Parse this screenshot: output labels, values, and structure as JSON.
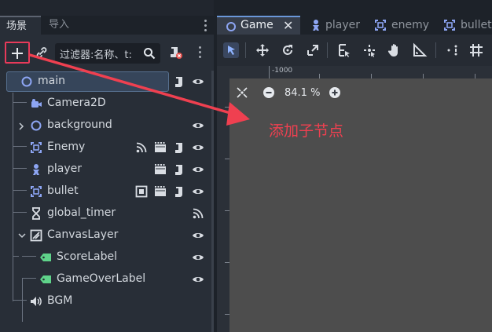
{
  "dock": {
    "scene_tab": "场景",
    "import_tab": "导入"
  },
  "scene_toolbar": {
    "add_icon": "plus-icon",
    "link_icon": "link-icon",
    "filter_placeholder": "过滤器:名称、t:",
    "filter_icon": "search-icon",
    "script_icon": "script-remove-icon",
    "menu_icon": "kebab-menu-icon"
  },
  "tree": [
    {
      "name": "main",
      "icon": "node2d-ring-icon",
      "selected": true,
      "right": [
        "script-icon",
        "eye-icon"
      ]
    },
    {
      "name": "Camera2D",
      "icon": "camera-icon",
      "right": []
    },
    {
      "name": "background",
      "icon": "node2d-ring-icon",
      "collapsed": true,
      "right": [
        "eye-icon"
      ]
    },
    {
      "name": "Enemy",
      "icon": "area2d-icon",
      "right": [
        "signal-icon",
        "scene-icon",
        "script-icon",
        "eye-icon"
      ]
    },
    {
      "name": "player",
      "icon": "character-icon",
      "right": [
        "scene-icon",
        "script-icon",
        "eye-icon"
      ]
    },
    {
      "name": "bullet",
      "icon": "area2d-icon",
      "right": [
        "group-icon",
        "scene-icon",
        "script-icon",
        "eye-icon"
      ]
    },
    {
      "name": "global_timer",
      "icon": "timer-icon",
      "right": [
        "signal-icon"
      ]
    },
    {
      "name": "CanvasLayer",
      "icon": "canvaslayer-icon",
      "expanded": true,
      "right": [
        "eye-icon"
      ]
    },
    {
      "name": "ScoreLabel",
      "icon": "label-icon",
      "right": [
        "eye-icon"
      ]
    },
    {
      "name": "GameOverLabel",
      "icon": "label-icon",
      "right": [
        "eye-icon"
      ]
    },
    {
      "name": "BGM",
      "icon": "audio-icon",
      "right": []
    }
  ],
  "editor_tabs": [
    {
      "label": "Game",
      "active": true,
      "icon": "node2d-ring-icon",
      "close": "✕"
    },
    {
      "label": "player",
      "icon": "character-icon"
    },
    {
      "label": "enemy",
      "icon": "area2d-icon"
    },
    {
      "label": "bullet",
      "icon": "area2d-icon"
    }
  ],
  "viewport": {
    "ruler_label": "-1000",
    "zoom": "84.1 %"
  },
  "annotation": {
    "text": "添加子节点",
    "color": "#ef4050"
  },
  "colors": {
    "accent": "#6a97d8",
    "highlight": "#e83a5a",
    "node_blue": "#8da5f3",
    "label_green": "#5fd38a"
  }
}
